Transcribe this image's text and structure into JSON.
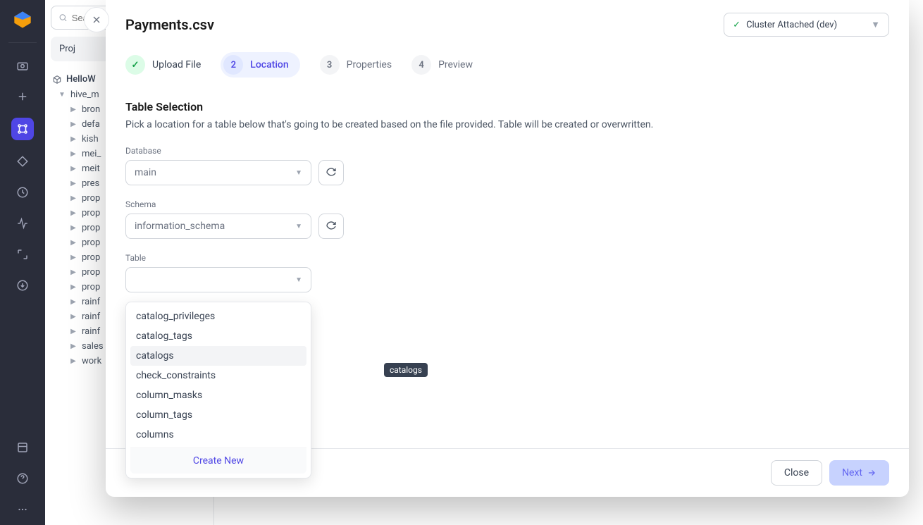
{
  "search": {
    "placeholder": "Search"
  },
  "sidebar": {
    "project_tab": "Proj",
    "project_name": "HelloW",
    "root": "hive_m",
    "items": [
      "bron",
      "defa",
      "kish",
      "mei_",
      "meit",
      "pres",
      "prop",
      "prop",
      "prop",
      "prop",
      "prop",
      "prop",
      "prop",
      "rainf",
      "rainf",
      "rainf",
      "sales",
      "work"
    ]
  },
  "modal": {
    "title": "Payments.csv",
    "cluster": "Cluster Attached (dev)",
    "steps": {
      "s1": "Upload File",
      "s2_num": "2",
      "s2": "Location",
      "s3_num": "3",
      "s3": "Properties",
      "s4_num": "4",
      "s4": "Preview"
    },
    "section_title": "Table Selection",
    "section_desc": "Pick a location for a table below that's going to be created based on the file provided. Table will be created or overwritten.",
    "fields": {
      "database_label": "Database",
      "database_value": "main",
      "schema_label": "Schema",
      "schema_value": "information_schema",
      "table_label": "Table",
      "table_value": ""
    },
    "dropdown": {
      "items": [
        "catalog_privileges",
        "catalog_tags",
        "catalogs",
        "check_constraints",
        "column_masks",
        "column_tags",
        "columns"
      ],
      "hover_index": 2,
      "create_new": "Create New"
    },
    "tooltip": "catalogs",
    "footer": {
      "close": "Close",
      "next": "Next"
    }
  }
}
